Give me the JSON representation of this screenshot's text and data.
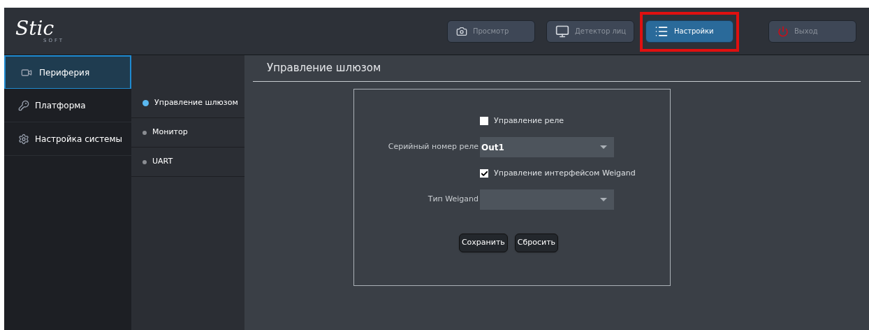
{
  "logo": {
    "text": "Stic",
    "subtext": "SOFT"
  },
  "top_nav": [
    {
      "label": "Просмотр",
      "selected": false,
      "highlighted": false
    },
    {
      "label": "Детектор лиц",
      "selected": false,
      "highlighted": false
    },
    {
      "label": "Настройки",
      "selected": true,
      "highlighted": true
    },
    {
      "label": "Выход",
      "selected": false,
      "highlighted": false
    }
  ],
  "sidebar": {
    "items": [
      {
        "label": "Периферия",
        "selected": true
      },
      {
        "label": "Платформа",
        "selected": false
      },
      {
        "label": "Настройка системы",
        "selected": false
      }
    ]
  },
  "subnav": {
    "items": [
      {
        "label": "Управление шлюзом",
        "selected": true
      },
      {
        "label": "Монитор",
        "selected": false
      },
      {
        "label": "UART",
        "selected": false
      }
    ]
  },
  "page_title": "Управление шлюзом",
  "form": {
    "fields": [
      {
        "kind": "checkbox",
        "label": "Управление реле",
        "checked": false
      },
      {
        "kind": "select",
        "label": "Серийный номер реле",
        "value": "Out1"
      },
      {
        "kind": "checkbox",
        "label": "Управление интерфейсом Weigand",
        "checked": true
      },
      {
        "kind": "select",
        "label": "Тип Weigand"
      }
    ],
    "buttons": [
      "Сохранить",
      "Сбросить"
    ]
  }
}
